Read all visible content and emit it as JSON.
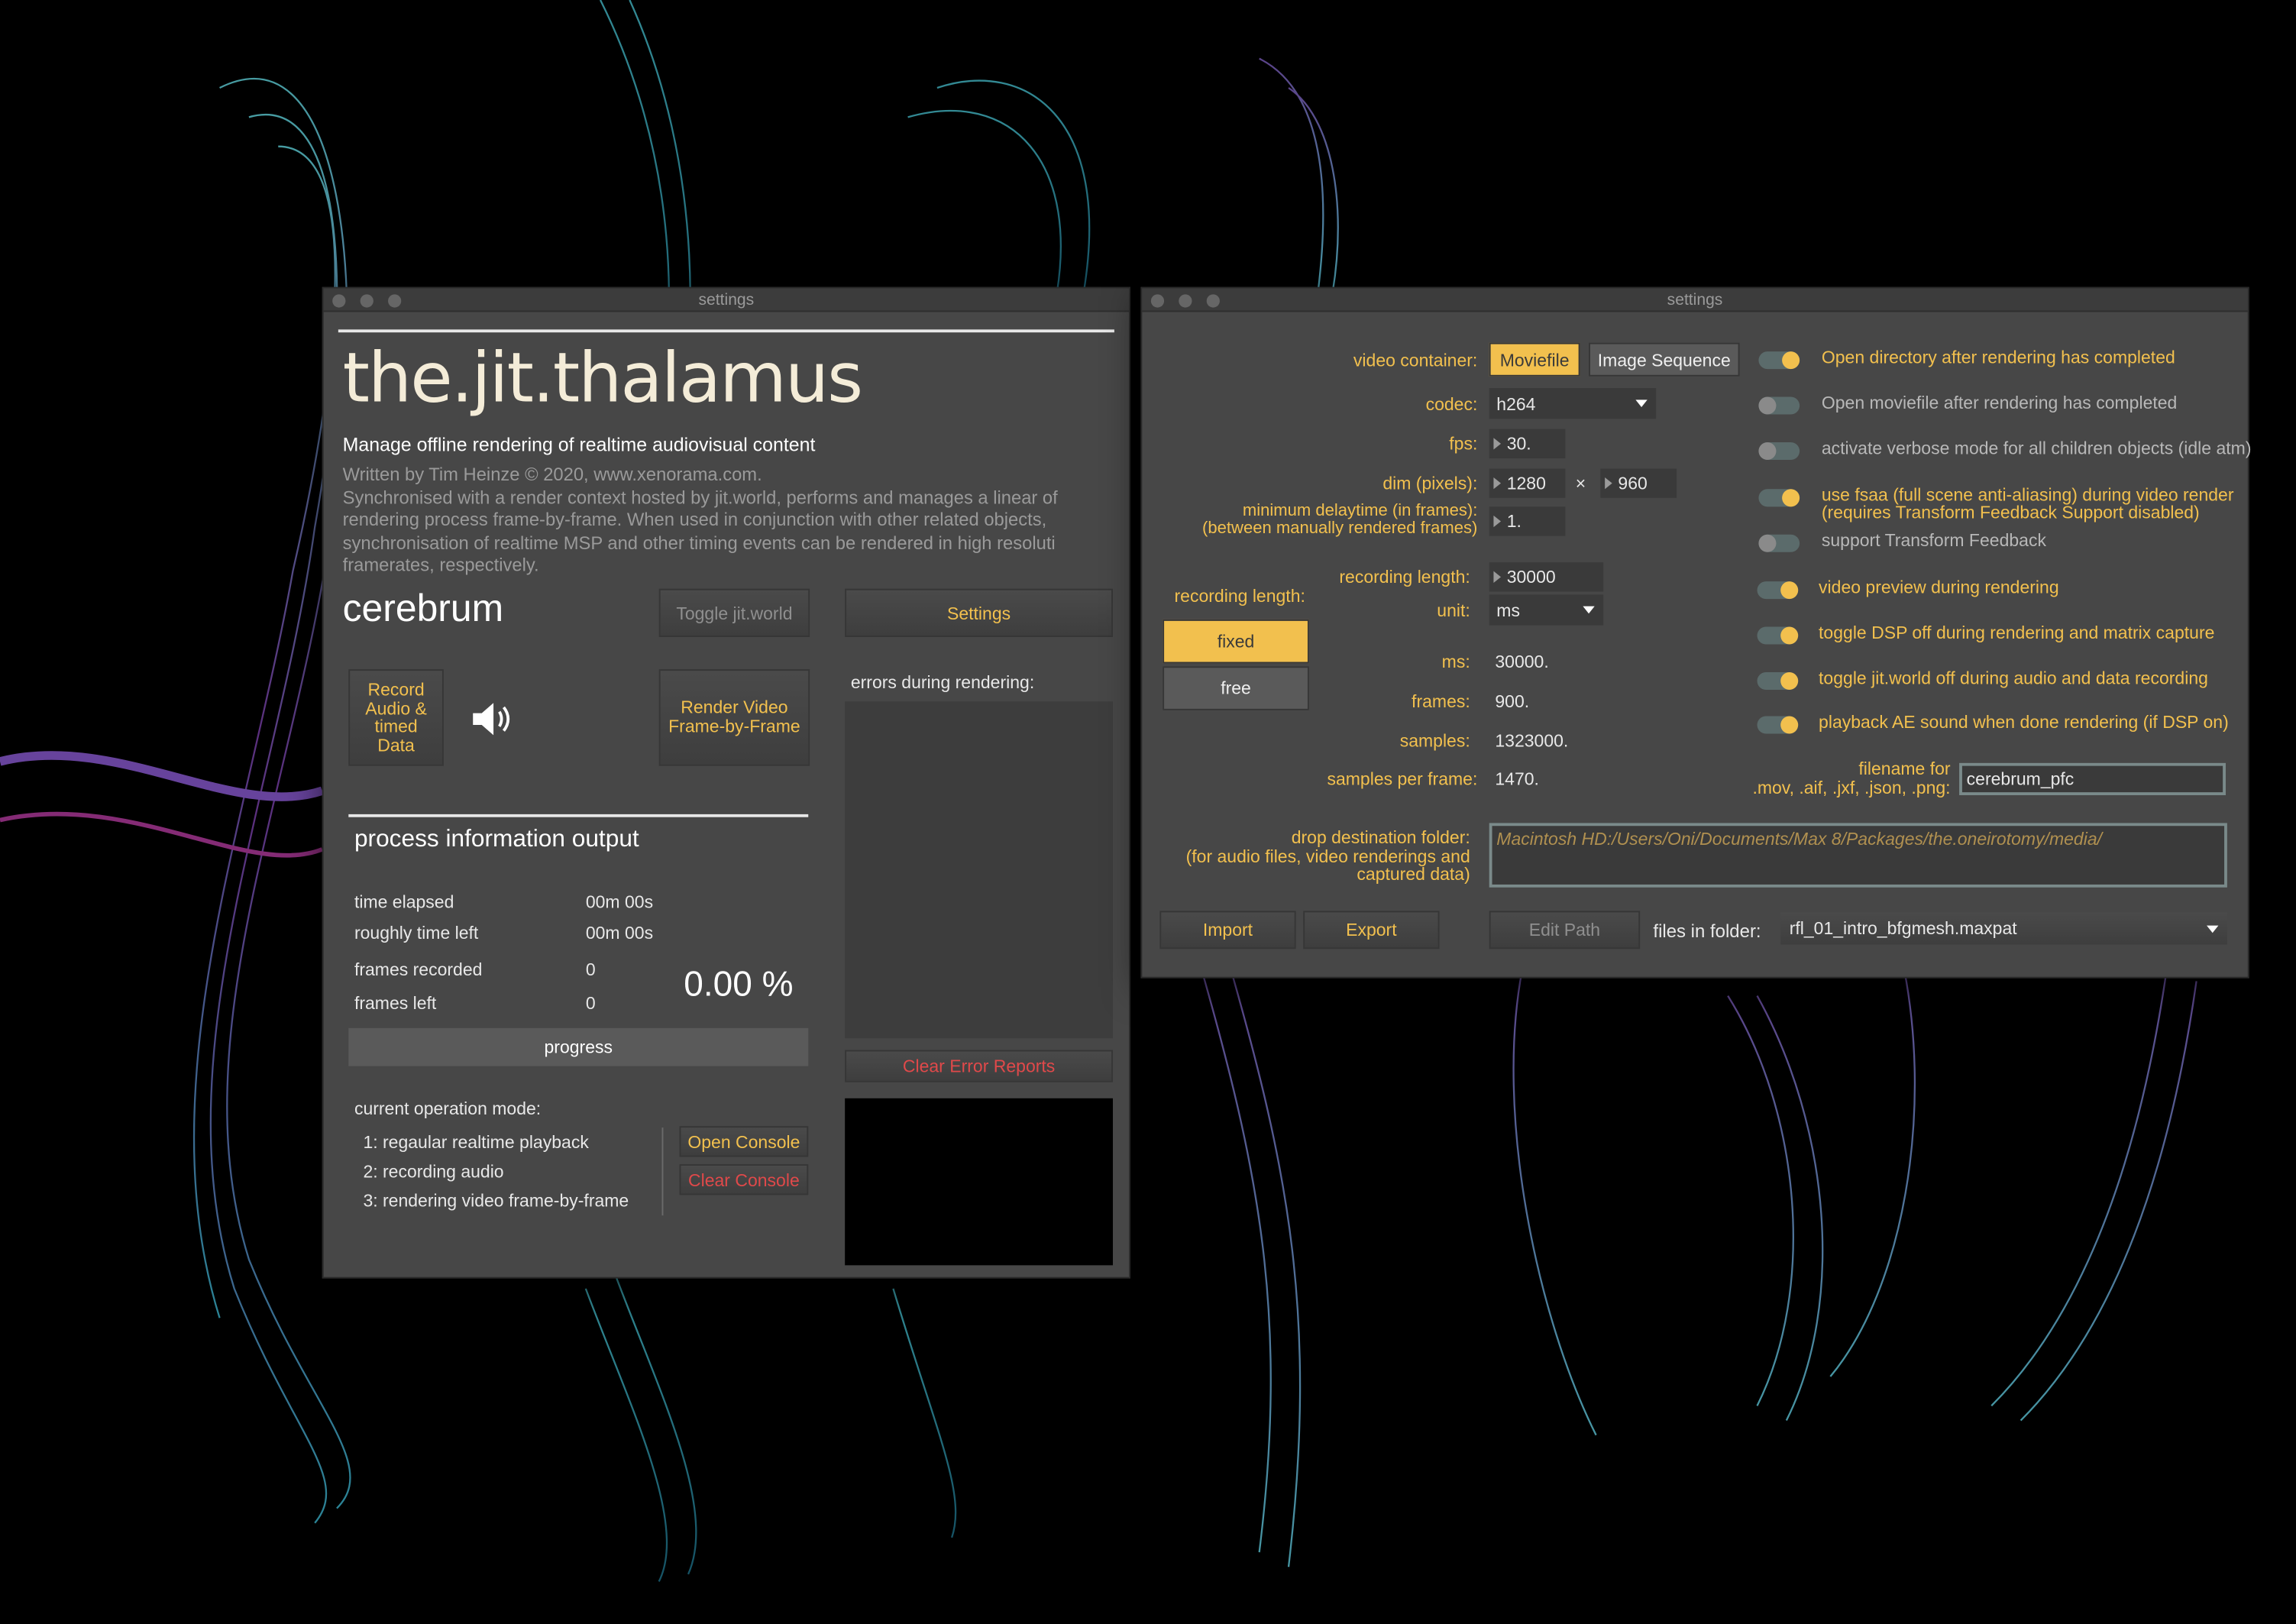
{
  "colors": {
    "accent": "#f2c04e",
    "error": "#e0494a",
    "window_bg": "#474747",
    "background": "#000000"
  },
  "left": {
    "window_title": "settings",
    "app_title": "the.jit.thalamus",
    "subtitle": "Manage offline rendering of realtime audiovisual content",
    "desc_lines": [
      "Written by Tim Heinze © 2020, www.xenorama.com.",
      "Synchronised with a render context hosted by jit.world, performs and manages a linear of",
      "rendering process frame-by-frame. When used in conjunction with other related objects,",
      "synchronisation of realtime MSP and other timing events can be rendered in high resoluti",
      "framerates, respectively."
    ],
    "context_name": "cerebrum",
    "toggle_world": "Toggle jit.world",
    "settings": "Settings",
    "record_lines": [
      "Record",
      "Audio &",
      "timed",
      "Data"
    ],
    "speaker_icon": "speaker-icon",
    "render_lines": [
      "Render Video",
      "Frame-by-Frame"
    ],
    "errors_label": "errors during rendering:",
    "process_title": "process information output",
    "time_elapsed_label": "time elapsed",
    "time_elapsed": "00m 00s",
    "time_left_label": "roughly time left",
    "time_left": "00m 00s",
    "frames_recorded_label": "frames recorded",
    "frames_recorded": "0",
    "frames_left_label": "frames left",
    "frames_left": "0",
    "percent": "0.00 %",
    "progress_label": "progress",
    "progress_fraction": 0,
    "mode_label": "current operation mode:",
    "modes": [
      "1: regaular realtime playback",
      "2: recording audio",
      "3: rendering video frame-by-frame"
    ],
    "open_console": "Open Console",
    "clear_console": "Clear Console",
    "clear_errors": "Clear Error Reports"
  },
  "right": {
    "window_title": "settings",
    "video_container_label": "video container:",
    "moviefile": "Moviefile",
    "image_sequence": "Image Sequence",
    "codec_label": "codec:",
    "codec": "h264",
    "fps_label": "fps:",
    "fps": "30.",
    "dim_label": "dim (pixels):",
    "dim_w": "1280",
    "dim_x": "×",
    "dim_h": "960",
    "min_delay_lines": [
      "minimum delaytime (in frames):",
      "(between manually rendered frames)"
    ],
    "min_delay": "1.",
    "rec_length_left": "recording length:",
    "fixed": "fixed",
    "free": "free",
    "rec_length_label": "recording length:",
    "rec_length": "30000",
    "unit_label": "unit:",
    "unit": "ms",
    "ms_label": "ms:",
    "ms": "30000.",
    "frames_label": "frames:",
    "frames": "900.",
    "samples_label": "samples:",
    "samples": "1323000.",
    "spf_label": "samples per frame:",
    "spf": "1470.",
    "toggles": [
      {
        "label": "Open directory after rendering has completed",
        "on": true
      },
      {
        "label": "Open moviefile after rendering has completed",
        "on": false
      },
      {
        "label": "activate verbose mode for all children objects (idle atm)",
        "on": false
      },
      {
        "label": "use fsaa (full scene anti-aliasing) during video render",
        "label2": "(requires Transform Feedback Support disabled)",
        "on": true
      },
      {
        "label": "support Transform Feedback",
        "on": false
      },
      {
        "label": "video preview during rendering",
        "on": true
      },
      {
        "label": "toggle DSP off during rendering and matrix capture",
        "on": true
      },
      {
        "label": "toggle jit.world off during audio and data recording",
        "on": true
      },
      {
        "label": "playback AE sound when done rendering (if DSP on)",
        "on": true
      }
    ],
    "filename_lines": [
      "filename for",
      ".mov, .aif, .jxf, .json, .png:"
    ],
    "filename": "cerebrum_pfc",
    "drop_lines": [
      "drop destination folder:",
      "(for audio files, video renderings and",
      "captured data)"
    ],
    "path": "Macintosh HD:/Users/Oni/Documents/Max 8/Packages/the.oneirotomy/media/",
    "import": "Import",
    "export": "Export",
    "edit_path": "Edit Path",
    "files_label": "files in folder:",
    "file": "rfl_01_intro_bfgmesh.maxpat"
  }
}
